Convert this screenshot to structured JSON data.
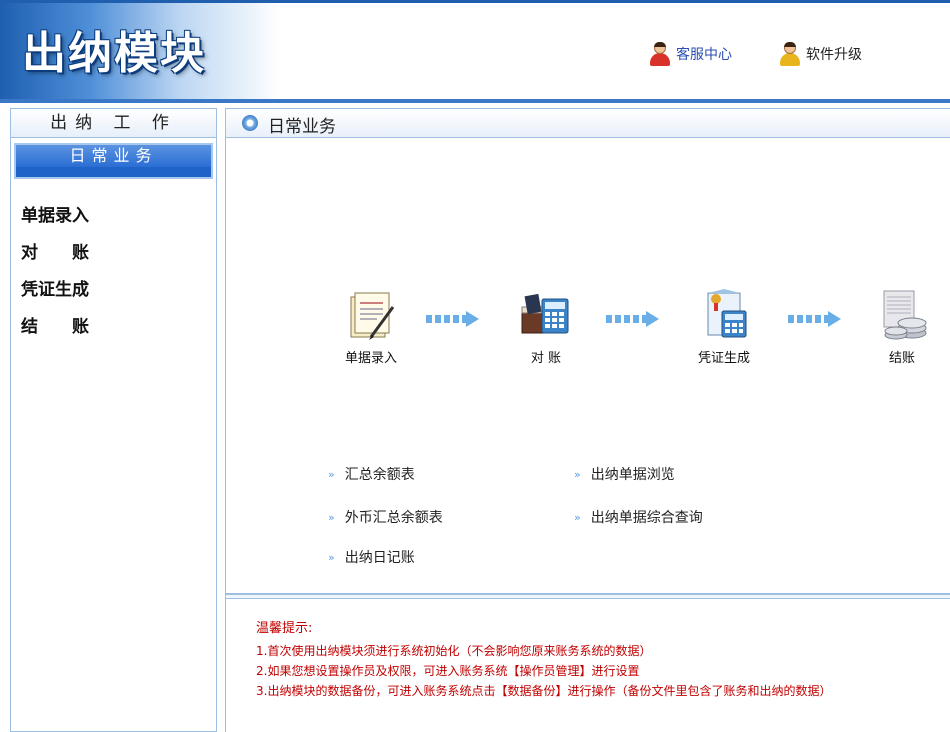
{
  "header": {
    "app_title": "出纳模块",
    "service_label": "客服中心",
    "upgrade_label": "软件升级"
  },
  "sidebar": {
    "title": "出纳 工 作",
    "section_label": "日常业务",
    "items": [
      {
        "label": "单据录入"
      },
      {
        "label": "对　　账"
      },
      {
        "label": "凭证生成"
      },
      {
        "label": "结　　账"
      }
    ]
  },
  "main": {
    "title": "日常业务",
    "flow": [
      {
        "label": "单据录入"
      },
      {
        "label": "对 账"
      },
      {
        "label": "凭证生成"
      },
      {
        "label": "结账"
      }
    ],
    "links_left": [
      "汇总余额表",
      "外币汇总余额表",
      "出纳日记账"
    ],
    "links_right": [
      "出纳单据浏览",
      "出纳单据综合查询"
    ],
    "bullet": "»",
    "tips": {
      "title": "温馨提示:",
      "lines": [
        "1.首次使用出纳模块须进行系统初始化（不会影响您原来账务系统的数据）",
        "2.如果您想设置操作员及权限，可进入账务系统【操作员管理】进行设置",
        "3.出纳模块的数据备份，可进入账务系统点击【数据备份】进行操作（备份文件里包含了账务和出纳的数据）"
      ]
    }
  },
  "colors": {
    "header_blue": "#1e5fb0",
    "accent_blue": "#1f62c8",
    "tip_red": "#c00000",
    "border_blue": "#9dbfe2"
  }
}
